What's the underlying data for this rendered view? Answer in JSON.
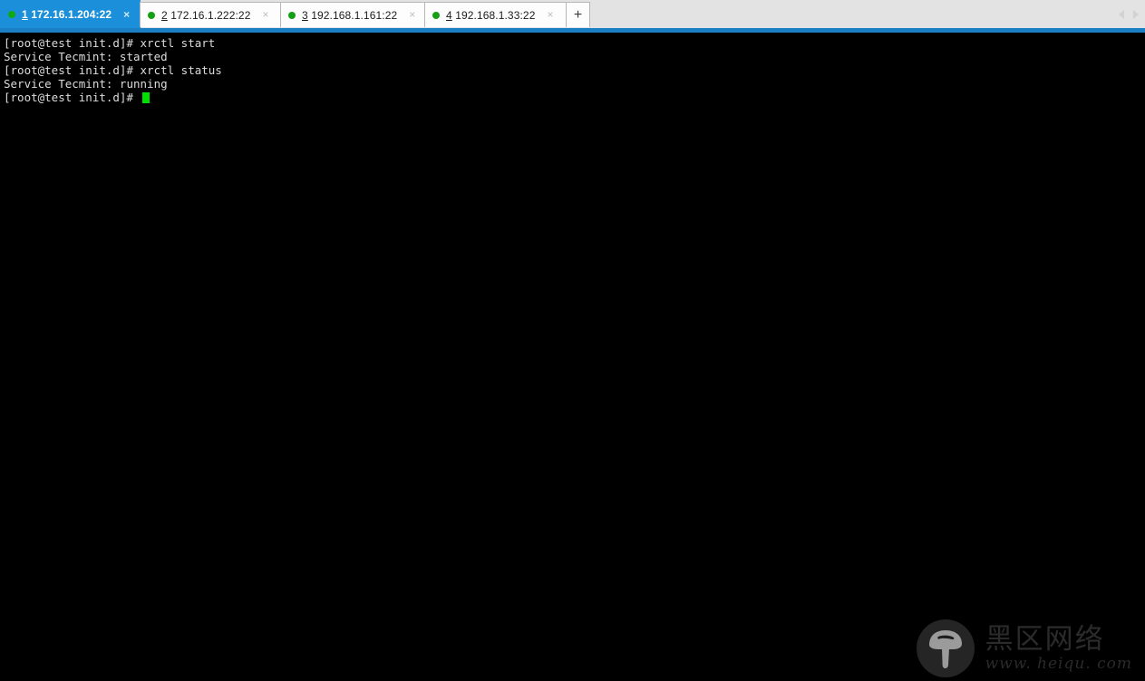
{
  "window": {
    "app_kind": "ssh-terminal-client",
    "accent_color": "#1b8fd9",
    "underline_color": "#1b7fc4",
    "tabbar_bg": "#e4e3e3",
    "terminal_bg": "#000000",
    "terminal_fg": "#dcdcdc",
    "cursor_color": "#00e000",
    "status_dot_color": "#14a014"
  },
  "tabbar": {
    "new_tab_label": "+",
    "scroll_left_icon": "chevron-left-icon",
    "scroll_right_icon": "chevron-right-icon",
    "tabs": [
      {
        "index": "1",
        "host": "172.16.1.204:22",
        "full_label": "1 172.16.1.204:22",
        "status": "connected",
        "active": true,
        "close_label": "×"
      },
      {
        "index": "2",
        "host": "172.16.1.222:22",
        "full_label": "2 172.16.1.222:22",
        "status": "connected",
        "active": false,
        "close_label": "×"
      },
      {
        "index": "3",
        "host": "192.168.1.161:22",
        "full_label": "3 192.168.1.161:22",
        "status": "connected",
        "active": false,
        "close_label": "×"
      },
      {
        "index": "4",
        "host": "192.168.1.33:22",
        "full_label": "4 192.168.1.33:22",
        "status": "connected",
        "active": false,
        "close_label": "×"
      }
    ]
  },
  "terminal": {
    "lines": [
      "[root@test init.d]# xrctl start",
      "Service Tecmint: started",
      "[root@test init.d]# xrctl status",
      "Service Tecmint: running"
    ],
    "prompt": "[root@test init.d]# ",
    "cursor_visible": true
  },
  "watermark": {
    "logo_icon": "mushroom-logo-icon",
    "cn_text": "黑区网络",
    "en_text": "www. heiqu. com"
  }
}
